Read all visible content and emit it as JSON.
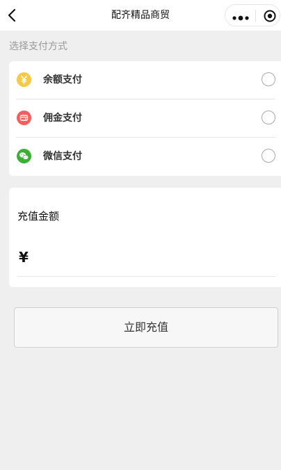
{
  "navbar": {
    "title": "配齐精品商贸",
    "back_icon": "chevron-left-icon",
    "more_icon": "more-dots-icon",
    "close_icon": "target-circle-icon"
  },
  "payment": {
    "section_label": "选择支付方式",
    "methods": [
      {
        "label": "余额支付",
        "icon": "yen-coin-icon",
        "icon_color": "#f7c948",
        "selected": false
      },
      {
        "label": "佣金支付",
        "icon": "commission-icon",
        "icon_color": "#f25f5c",
        "selected": false
      },
      {
        "label": "微信支付",
        "icon": "wechat-icon",
        "icon_color": "#3cb034",
        "selected": false
      }
    ]
  },
  "recharge": {
    "title": "充值金额",
    "currency_symbol": "¥",
    "amount_value": "",
    "button_label": "立即充值"
  }
}
